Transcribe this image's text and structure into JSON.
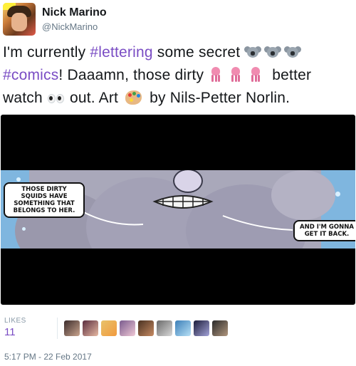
{
  "tweet": {
    "author_name": "Nick Marino",
    "author_handle": "@NickMarino",
    "text_parts": {
      "p1": "I'm currently ",
      "hashtag1": "#lettering",
      "p2": " some secret ",
      "hashtag2": "#comics",
      "p3": "! Daaamn, those dirty ",
      "p4": " better watch ",
      "p5": " out. Art ",
      "p6": " by Nils-Petter Norlin."
    },
    "emoji_names": [
      "koala-emoji",
      "squid-emoji",
      "eyes-emoji",
      "artist-palette-emoji"
    ],
    "hashtag_color": "#7a4dc4"
  },
  "media": {
    "bubble_left": "THOSE DIRTY SQUIDS HAVE SOMETHING THAT BELONGS TO HER.",
    "bubble_right": "AND I'M GONNA GET IT BACK."
  },
  "stats": {
    "likes_label": "LIKES",
    "likes_count": "11",
    "liker_count_shown": 10
  },
  "timestamp": "5:17 PM - 22 Feb 2017"
}
